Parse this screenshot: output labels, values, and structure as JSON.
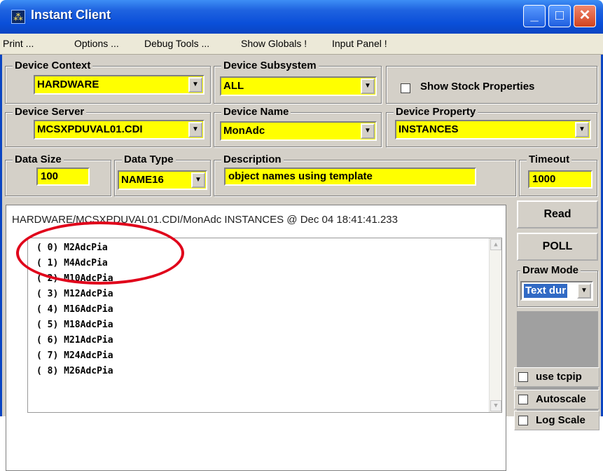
{
  "window": {
    "title": "Instant Client",
    "icon": "app-grid-icon"
  },
  "window_buttons": {
    "minimize": "_",
    "maximize": "□",
    "close": "✕"
  },
  "menu": [
    {
      "label": "Print ..."
    },
    {
      "label": "Options ..."
    },
    {
      "label": "Debug Tools ..."
    },
    {
      "label": "Show Globals !"
    },
    {
      "label": "Input Panel !"
    }
  ],
  "device_context": {
    "label": "Device Context",
    "value": "HARDWARE"
  },
  "device_subsystem": {
    "label": "Device Subsystem",
    "value": "ALL"
  },
  "show_stock": {
    "label": "Show Stock Properties",
    "checked": false
  },
  "device_server": {
    "label": "Device Server",
    "value": "MCSXPDUVAL01.CDI"
  },
  "device_name": {
    "label": "Device Name",
    "value": "MonAdc"
  },
  "device_property": {
    "label": "Device Property",
    "value": "INSTANCES"
  },
  "data_size": {
    "label": "Data Size",
    "value": "100"
  },
  "data_type": {
    "label": "Data Type",
    "value": "NAME16"
  },
  "description": {
    "label": "Description",
    "value": "object names using template"
  },
  "timeout": {
    "label": "Timeout",
    "value": "1000"
  },
  "buttons": {
    "read": "Read",
    "poll": "POLL"
  },
  "draw_mode": {
    "label": "Draw Mode",
    "value": "Text dur"
  },
  "options": {
    "use_tcpip": "use tcpip",
    "autoscale": "Autoscale",
    "log_scale": "Log Scale"
  },
  "output": {
    "header": "HARDWARE/MCSXPDUVAL01.CDI/MonAdc INSTANCES @ Dec 04 18:41:41.233",
    "items": [
      "( 0) M2AdcPia",
      "( 1) M4AdcPia",
      "( 2) M10AdcPia",
      "( 3) M12AdcPia",
      "( 4) M16AdcPia",
      "( 5) M18AdcPia",
      "( 6) M21AdcPia",
      "( 7) M24AdcPia",
      "( 8) M26AdcPia"
    ]
  },
  "colors": {
    "field_bg": "#ffff00",
    "title_blue": "#0a4fd9",
    "highlight": "#e0001a"
  }
}
